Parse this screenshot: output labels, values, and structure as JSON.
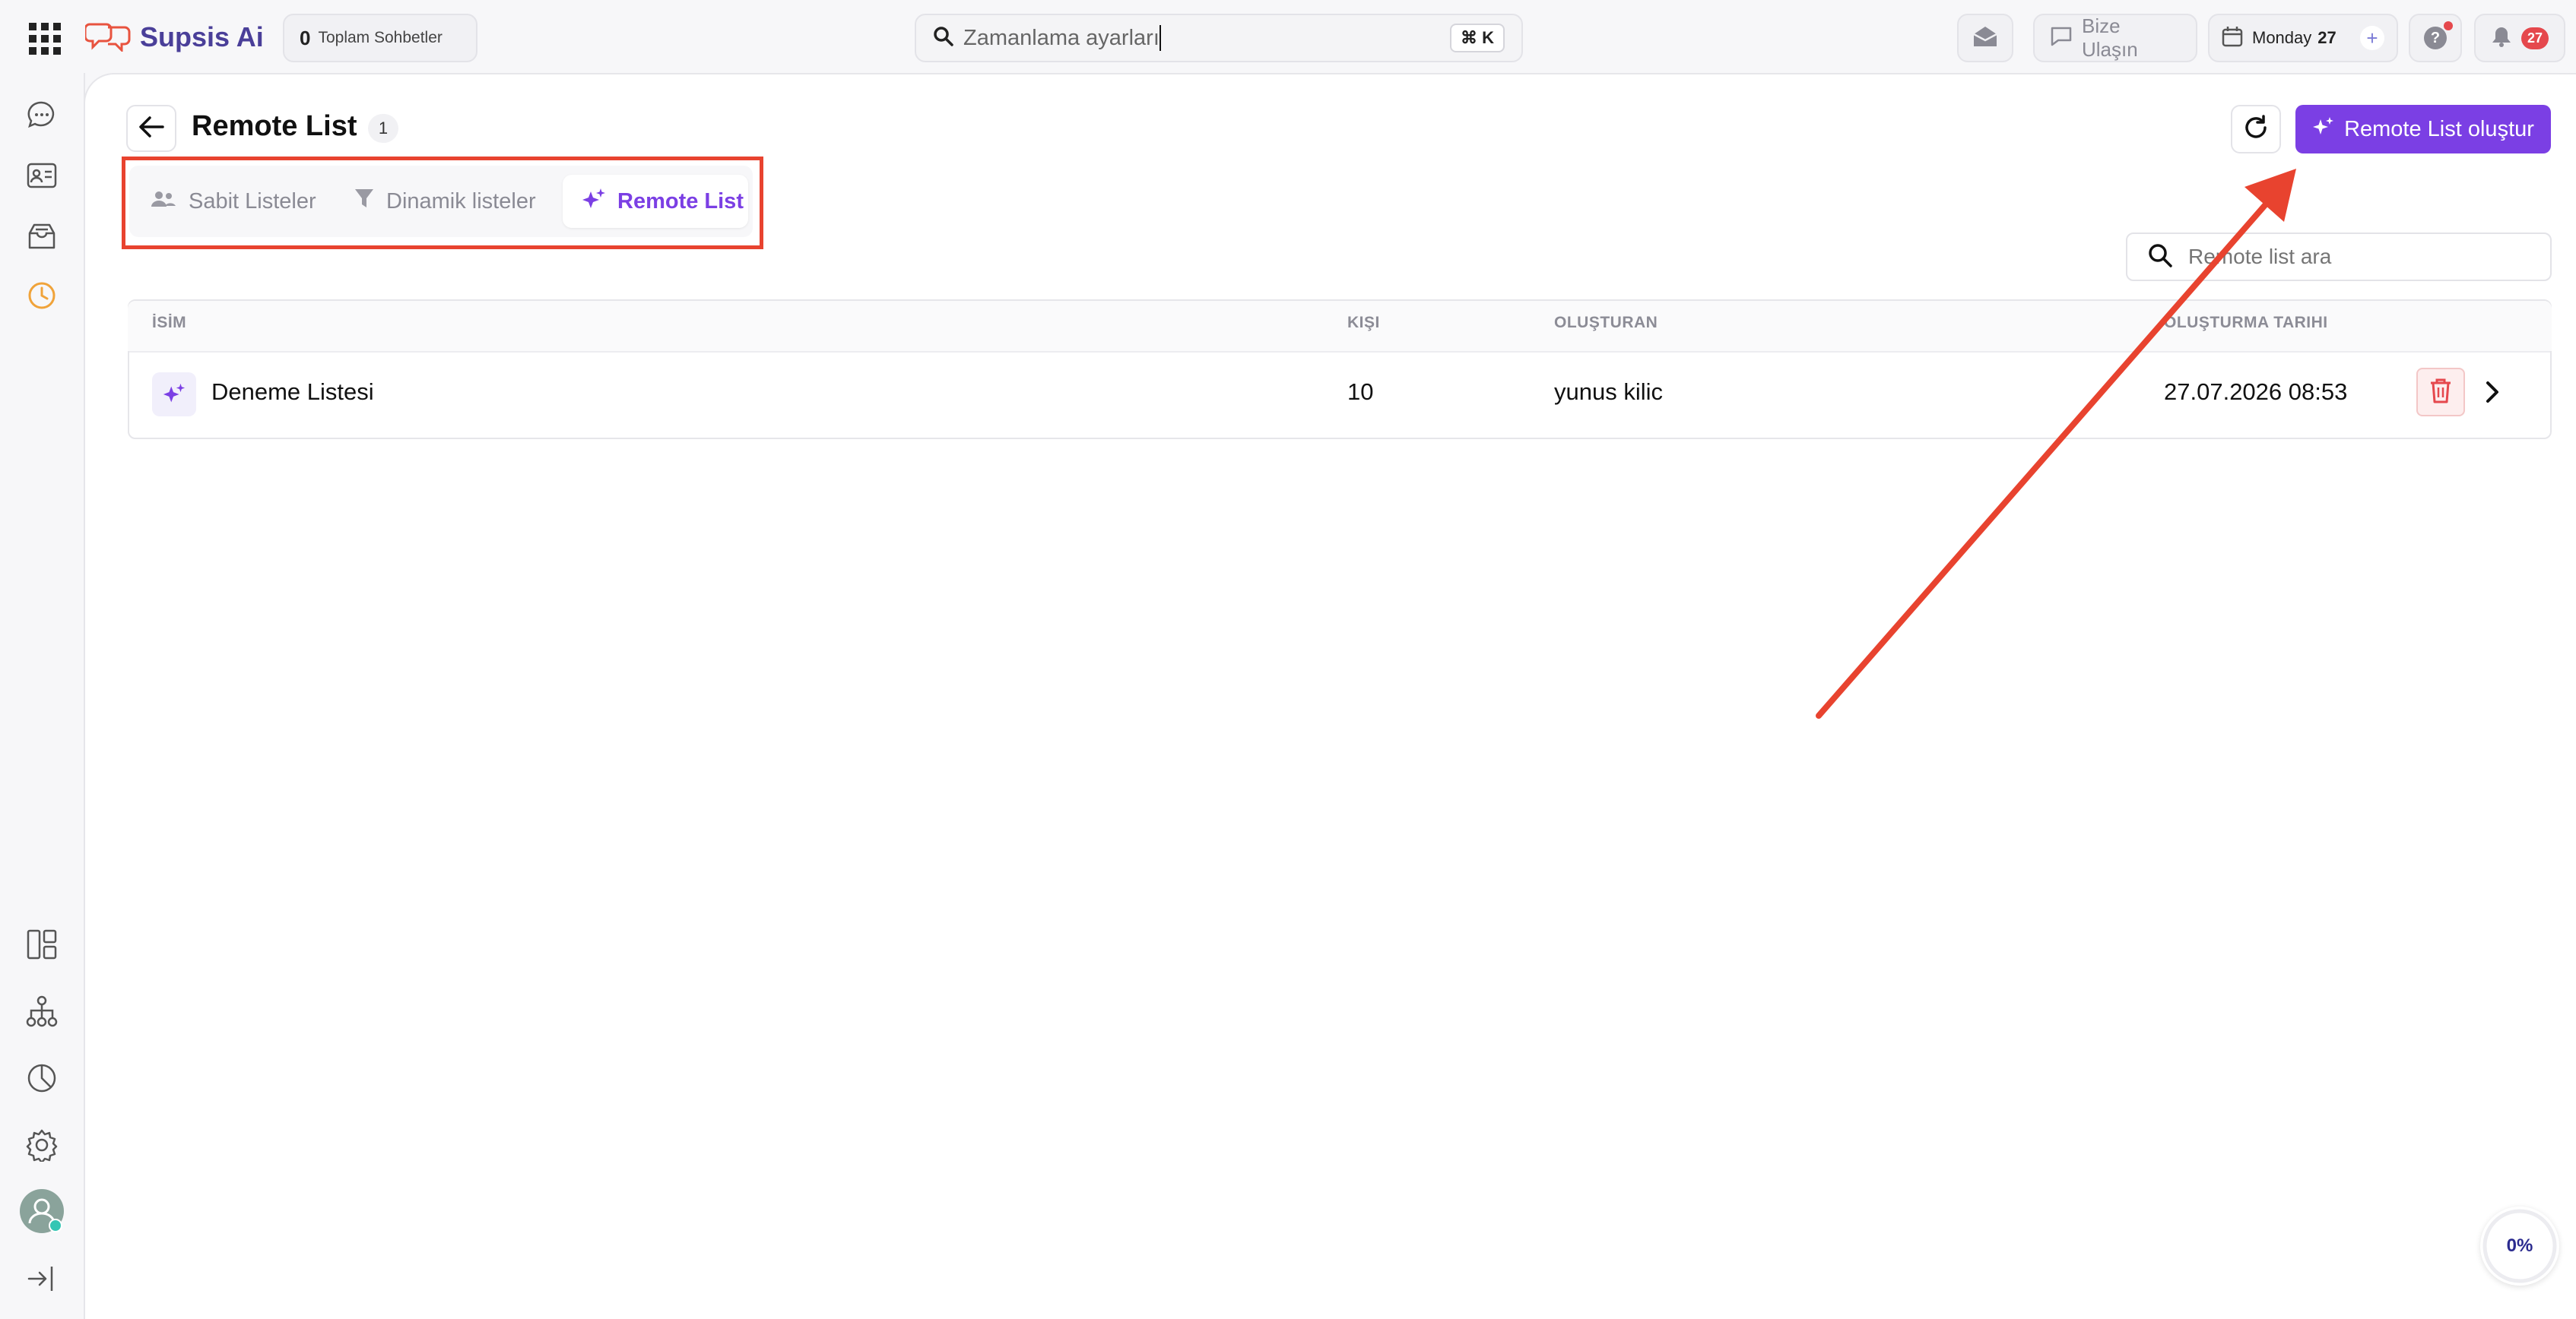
{
  "topbar": {
    "brand": "Supsis Ai",
    "conversations_count": "0",
    "conversations_label": "Toplam Sohbetler",
    "search_value": "Zamanlama ayarları",
    "shortcut": "⌘ K",
    "contact_label": "Bize Ulaşın",
    "date_day": "Monday",
    "date_num": "27",
    "notifications_count": "27"
  },
  "page": {
    "title": "Remote List",
    "count": "1",
    "create_button": "Remote List oluştur",
    "search_placeholder": "Remote list ara"
  },
  "tabs": [
    {
      "label": "Sabit Listeler",
      "icon": "people-icon",
      "active": false
    },
    {
      "label": "Dinamik listeler",
      "icon": "filter-icon",
      "active": false
    },
    {
      "label": "Remote List",
      "icon": "sparkle-icon",
      "active": true
    }
  ],
  "table": {
    "headers": [
      "İSİM",
      "KIŞI",
      "OLUŞTURAN",
      "OLUŞTURMA TARIHI"
    ],
    "rows": [
      {
        "name": "Deneme Listesi",
        "people": "10",
        "creator": "yunus kilic",
        "created": "27.07.2026 08:53"
      }
    ]
  },
  "progress": {
    "label": "0%",
    "value": 0
  },
  "colors": {
    "accent": "#7b3fe4",
    "annotation": "#e8432f",
    "danger": "#e5484d"
  },
  "annotations": {
    "highlight_box": "tabs",
    "arrow_target": "create-button"
  }
}
